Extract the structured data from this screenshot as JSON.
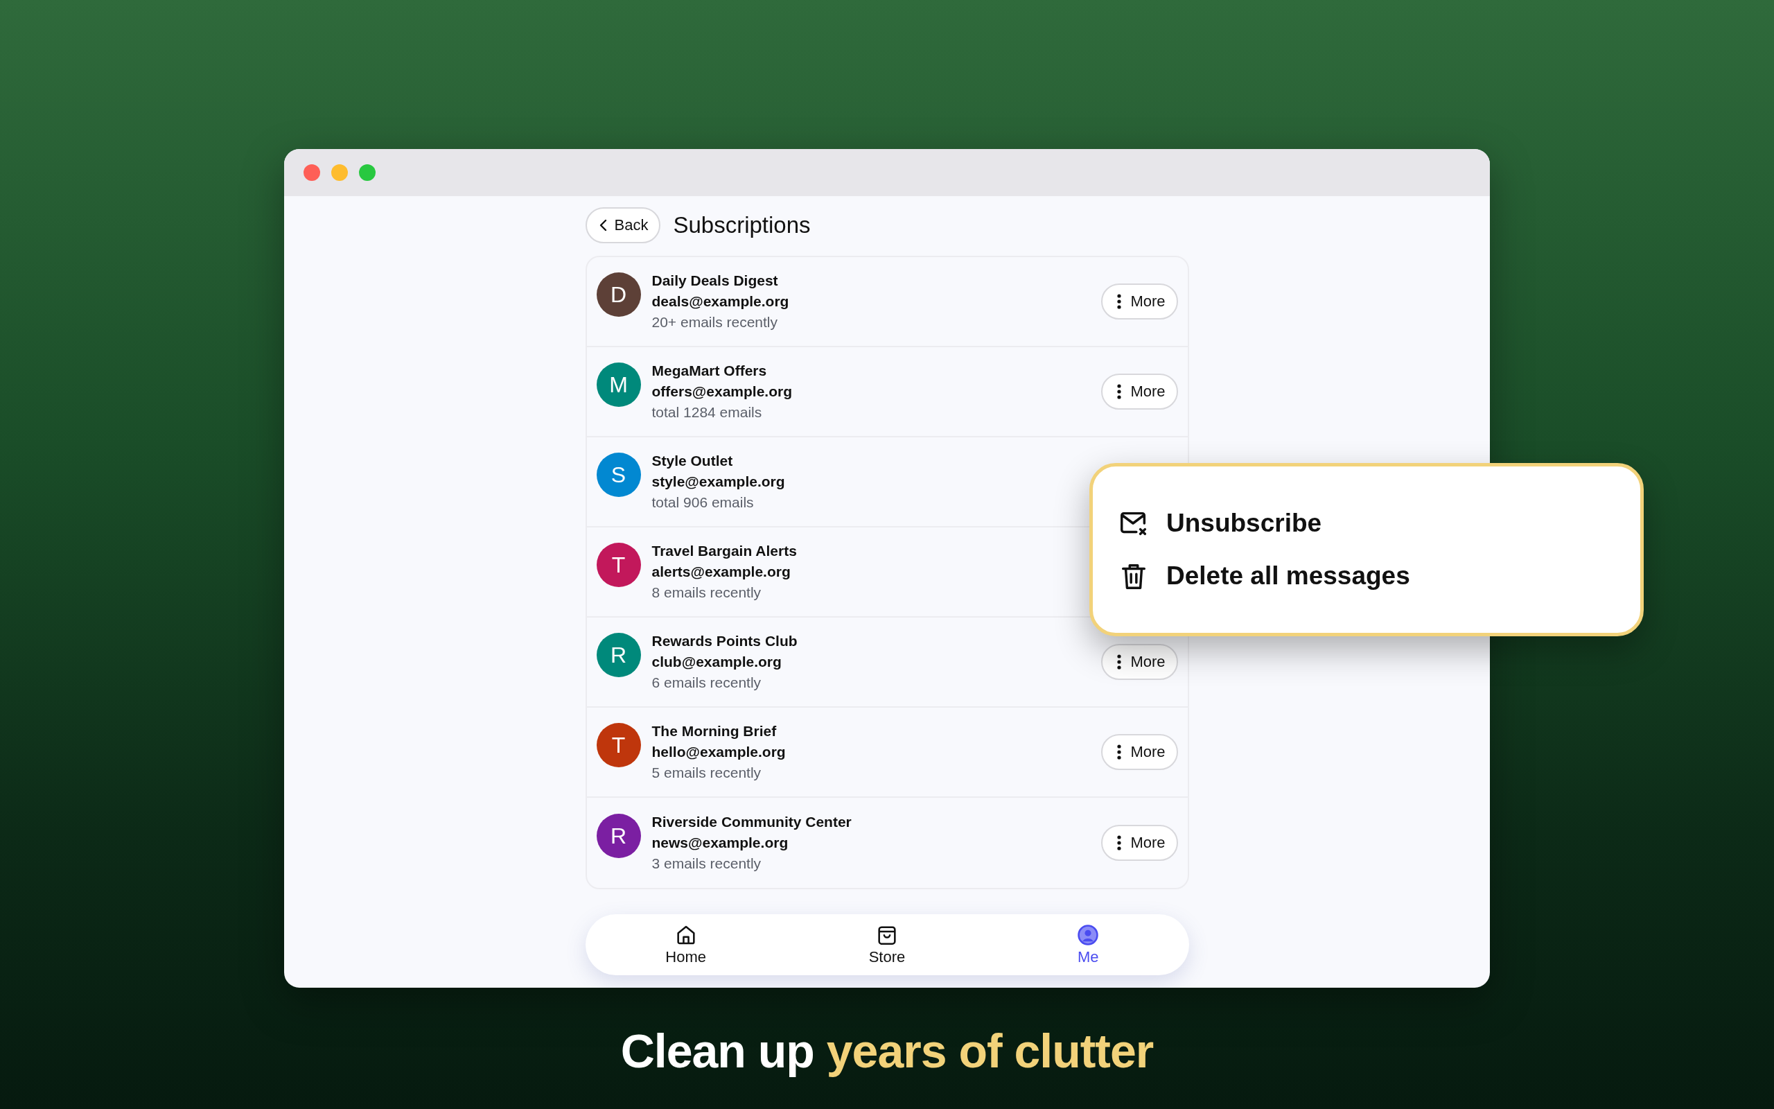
{
  "window": {
    "title": "Subscriptions",
    "back": "Back"
  },
  "subscriptions": [
    {
      "initial": "D",
      "color": "#5d4037",
      "name": "Daily Deals Digest",
      "email": "deals@example.org",
      "count": "20+ emails recently",
      "more": "More"
    },
    {
      "initial": "M",
      "color": "#00897b",
      "name": "MegaMart Offers",
      "email": "offers@example.org",
      "count": "total 1284 emails",
      "more": "More"
    },
    {
      "initial": "S",
      "color": "#0288d1",
      "name": "Style Outlet",
      "email": "style@example.org",
      "count": "total 906 emails"
    },
    {
      "initial": "T",
      "color": "#c2185b",
      "name": "Travel Bargain Alerts",
      "email": "alerts@example.org",
      "count": "8 emails recently"
    },
    {
      "initial": "R",
      "color": "#00897b",
      "name": "Rewards Points Club",
      "email": "club@example.org",
      "count": "6 emails recently",
      "more": "More"
    },
    {
      "initial": "T",
      "color": "#bf360c",
      "name": "The Morning Brief",
      "email": "hello@example.org",
      "count": "5 emails recently",
      "more": "More"
    },
    {
      "initial": "R",
      "color": "#7b1fa2",
      "name": "Riverside Community Center",
      "email": "news@example.org",
      "count": "3 emails recently",
      "more": "More"
    }
  ],
  "menu": [
    {
      "kind": "unsubscribe",
      "label": "Unsubscribe"
    },
    {
      "kind": "delete",
      "label": "Delete all messages"
    }
  ],
  "tabs": [
    {
      "kind": "home",
      "label": "Home",
      "selected": false
    },
    {
      "kind": "store",
      "label": "Store",
      "selected": false
    },
    {
      "kind": "me",
      "label": "Me",
      "selected": true
    }
  ],
  "headline": {
    "text": "Clean up",
    "highlight": "years of clutter"
  }
}
